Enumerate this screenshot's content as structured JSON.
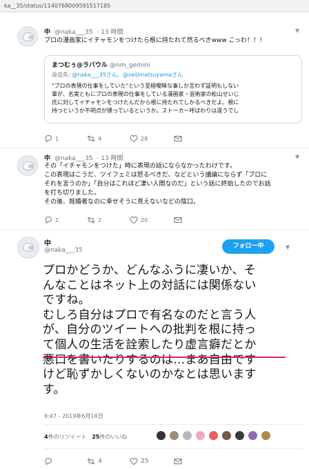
{
  "browser": {
    "url": "ka__35/status/1140768009591517185"
  },
  "tweets": [
    {
      "name": "中",
      "handle": "@naka___35",
      "time": "· 13 時間",
      "text": "プロの漫画家にイチャモンをつけたら根に持たれて然るべきwww こっわ！！！",
      "quote": {
        "name": "まつむぅ@ラバウル",
        "handle": "@nm_gemini",
        "reply_prefix": "返信先:",
        "reply_to": "@naka___35さん、@seijimatsuyamaさん",
        "lines": [
          "\"プロの表現の仕事をしていた\"という至極曖昧な事しか言わず証明もしない",
          "輩が、名実ともにプロの表現の仕事をしている漫画家・芸術家の松山せいじ",
          "氏に対してイチャモンをつけたんだから根に持たれてしかるべきだよ。根に",
          "持つというか不明点が燻っているというか。ストーカー呼ばわりは違うでし"
        ]
      },
      "replies": "1",
      "retweets": "4",
      "likes": "28"
    },
    {
      "name": "中",
      "handle": "@naka___35",
      "time": "· 13 時間",
      "lines": [
        "その「イチャモンをつけた」時に表現の話にならなかったわけです。",
        "この表現はこうだ、ツイフェミは怒るべきだ、などという議論にならず「プロに",
        "それを言うのか」「自分はこれほど凄い人間なのだ」という話に終始したのでお話",
        "を打ち切りました。",
        "その後、既婚者なのに幸せそうに見えないなどの陰口。"
      ],
      "replies": "2",
      "retweets": "2",
      "likes": "20"
    }
  ],
  "main_tweet": {
    "name": "中",
    "handle": "@naka___35",
    "follow_label": "フォロー中",
    "lines": [
      "プロかどうか、どんなふうに凄いか、そ",
      "んなことはネット上の対話には関係ない",
      "ですね。",
      "むしろ自分はプロで有名なのだと言う人",
      "が、自分のツイートへの批判を根に持っ",
      "て個人の生活を詮索したり虚言癖だとか",
      "悪口を書いたりするのは…まあ自由です",
      "けど恥ずかしくないのかなとは思います",
      "す。"
    ],
    "timestamp": "8:47 - 2019年6月18日",
    "retweet_count": "4",
    "retweet_label": "件のリツイート",
    "like_count": "25",
    "like_label": "件のいいね",
    "replies": "",
    "retweets": "4",
    "likes": "25",
    "liker_colors": [
      "#333333",
      "#9a8f6e",
      "#b8b8b8",
      "#f1a7c0",
      "#e8605c",
      "#6d5a4b",
      "#3a3a3a",
      "#8a6db3",
      "#b38a4e"
    ]
  }
}
